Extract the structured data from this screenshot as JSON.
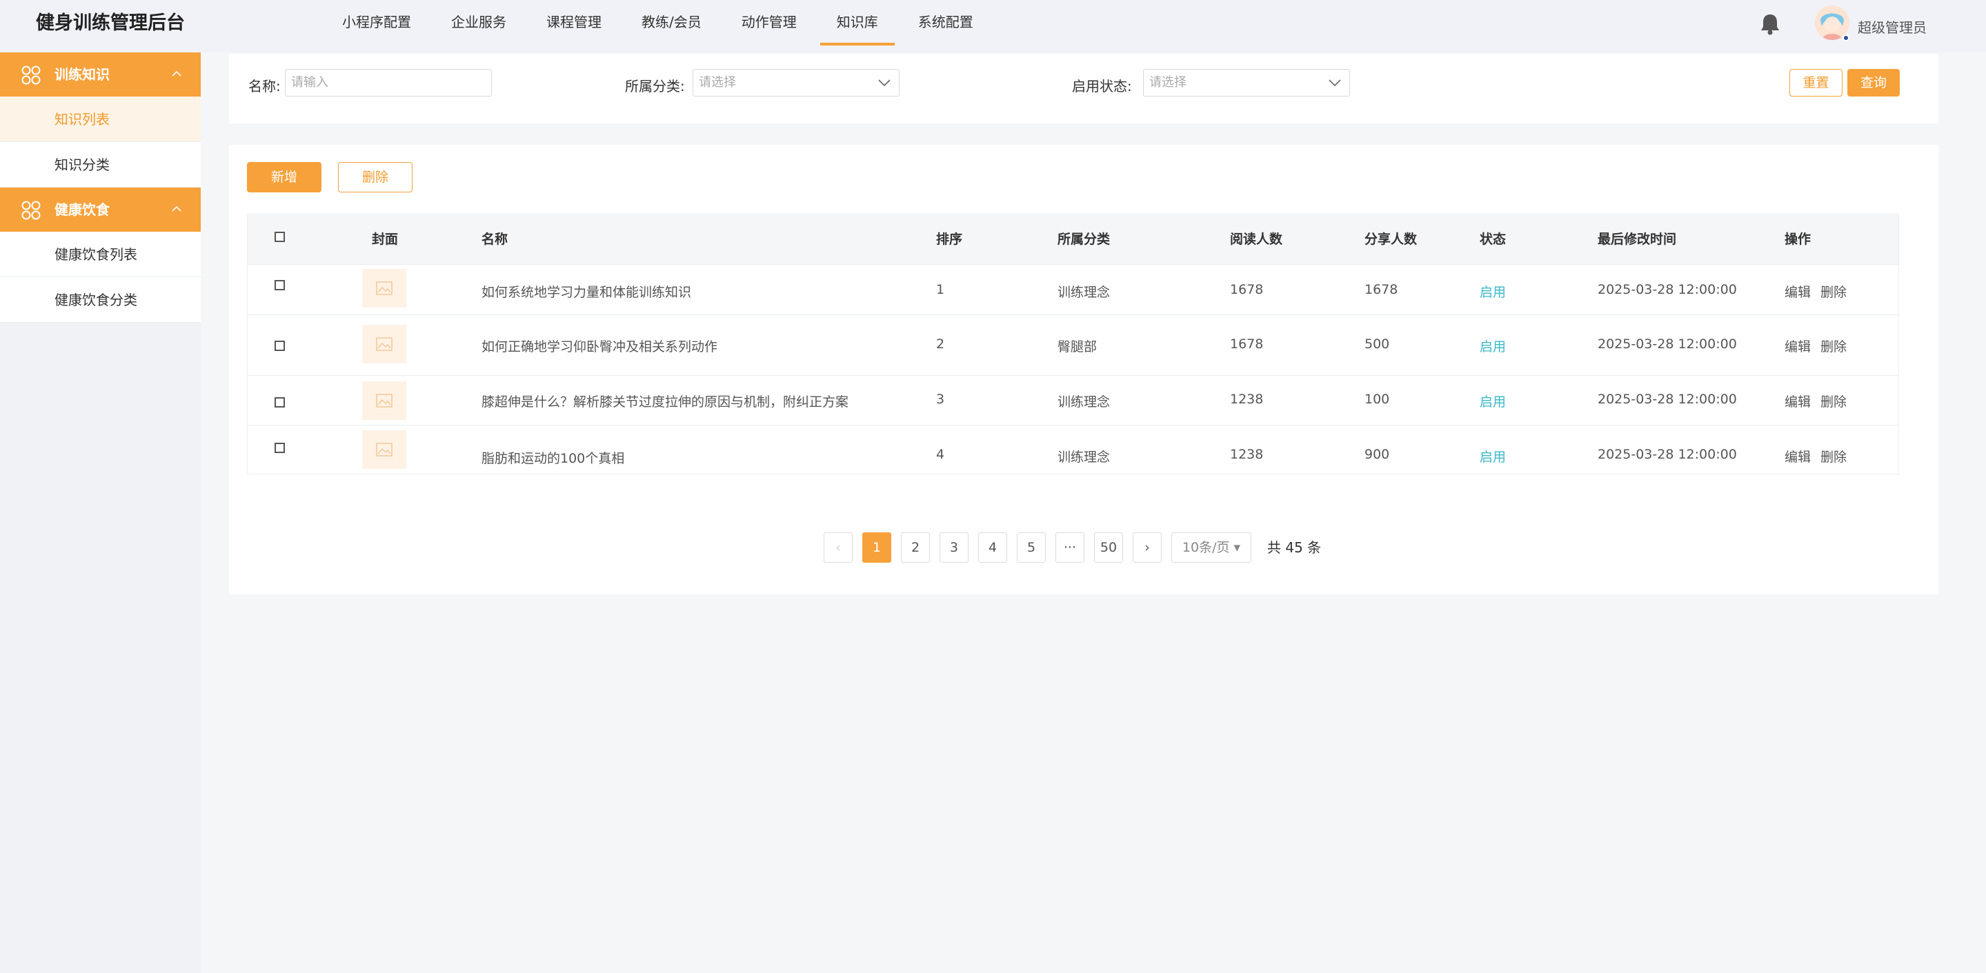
{
  "app": {
    "title": "健身训练管理后台"
  },
  "topnav": [
    {
      "label": "小程序配置",
      "active": false
    },
    {
      "label": "企业服务",
      "active": false
    },
    {
      "label": "课程管理",
      "active": false
    },
    {
      "label": "教练/会员",
      "active": false
    },
    {
      "label": "动作管理",
      "active": false
    },
    {
      "label": "知识库",
      "active": true
    },
    {
      "label": "系统配置",
      "active": false
    }
  ],
  "header": {
    "bell_icon": "bell-icon",
    "avatar_icon": "user-avatar",
    "admin_name": "超级管理员"
  },
  "sidebar": {
    "groups": [
      {
        "label": "训练知识",
        "icon": "category-icon",
        "items": [
          {
            "label": "知识列表",
            "active": true
          },
          {
            "label": "知识分类",
            "active": false
          }
        ]
      },
      {
        "label": "健康饮食",
        "icon": "category-icon",
        "items": [
          {
            "label": "健康饮食列表",
            "active": false
          },
          {
            "label": "健康饮食分类",
            "active": false
          }
        ]
      }
    ]
  },
  "filters": {
    "name_label": "名称:",
    "name_placeholder": "请输入",
    "category_label": "所属分类:",
    "category_placeholder": "请选择",
    "status_label": "启用状态:",
    "status_placeholder": "请选择",
    "reset_label": "重置",
    "search_label": "查询"
  },
  "toolbar": {
    "add_label": "新增",
    "delete_label": "删除"
  },
  "table": {
    "headers": {
      "cover": "封面",
      "name": "名称",
      "sort": "排序",
      "category": "所属分类",
      "reads": "阅读人数",
      "shares": "分享人数",
      "status": "状态",
      "modified": "最后修改时间",
      "actions": "操作"
    },
    "rows": [
      {
        "name": "如何系统地学习力量和体能训练知识",
        "sort": "1",
        "category": "训练理念",
        "reads": "1678",
        "shares": "1678",
        "status": "启用",
        "modified": "2025-03-28 12:00:00",
        "edit": "编辑",
        "delete": "删除"
      },
      {
        "name": "如何正确地学习仰卧臀冲及相关系列动作",
        "sort": "2",
        "category": "臀腿部",
        "reads": "1678",
        "shares": "500",
        "status": "启用",
        "modified": "2025-03-28 12:00:00",
        "edit": "编辑",
        "delete": "删除"
      },
      {
        "name": "膝超伸是什么？解析膝关节过度拉伸的原因与机制，附纠正方案",
        "sort": "3",
        "category": "训练理念",
        "reads": "1238",
        "shares": "100",
        "status": "启用",
        "modified": "2025-03-28 12:00:00",
        "edit": "编辑",
        "delete": "删除"
      },
      {
        "name": "脂肪和运动的100个真相",
        "sort": "4",
        "category": "训练理念",
        "reads": "1238",
        "shares": "900",
        "status": "启用",
        "modified": "2025-03-28 12:00:00",
        "edit": "编辑",
        "delete": "删除"
      }
    ]
  },
  "pagination": {
    "prev": "‹",
    "pages": [
      "1",
      "2",
      "3",
      "4",
      "5",
      "···",
      "50"
    ],
    "current": "1",
    "next": "›",
    "page_size": "10条/页 ▾",
    "total": "共 45 条"
  },
  "colors": {
    "accent": "#f7a13a",
    "status_enabled": "#3bb8c8",
    "page_bg": "#f5f6f8"
  }
}
